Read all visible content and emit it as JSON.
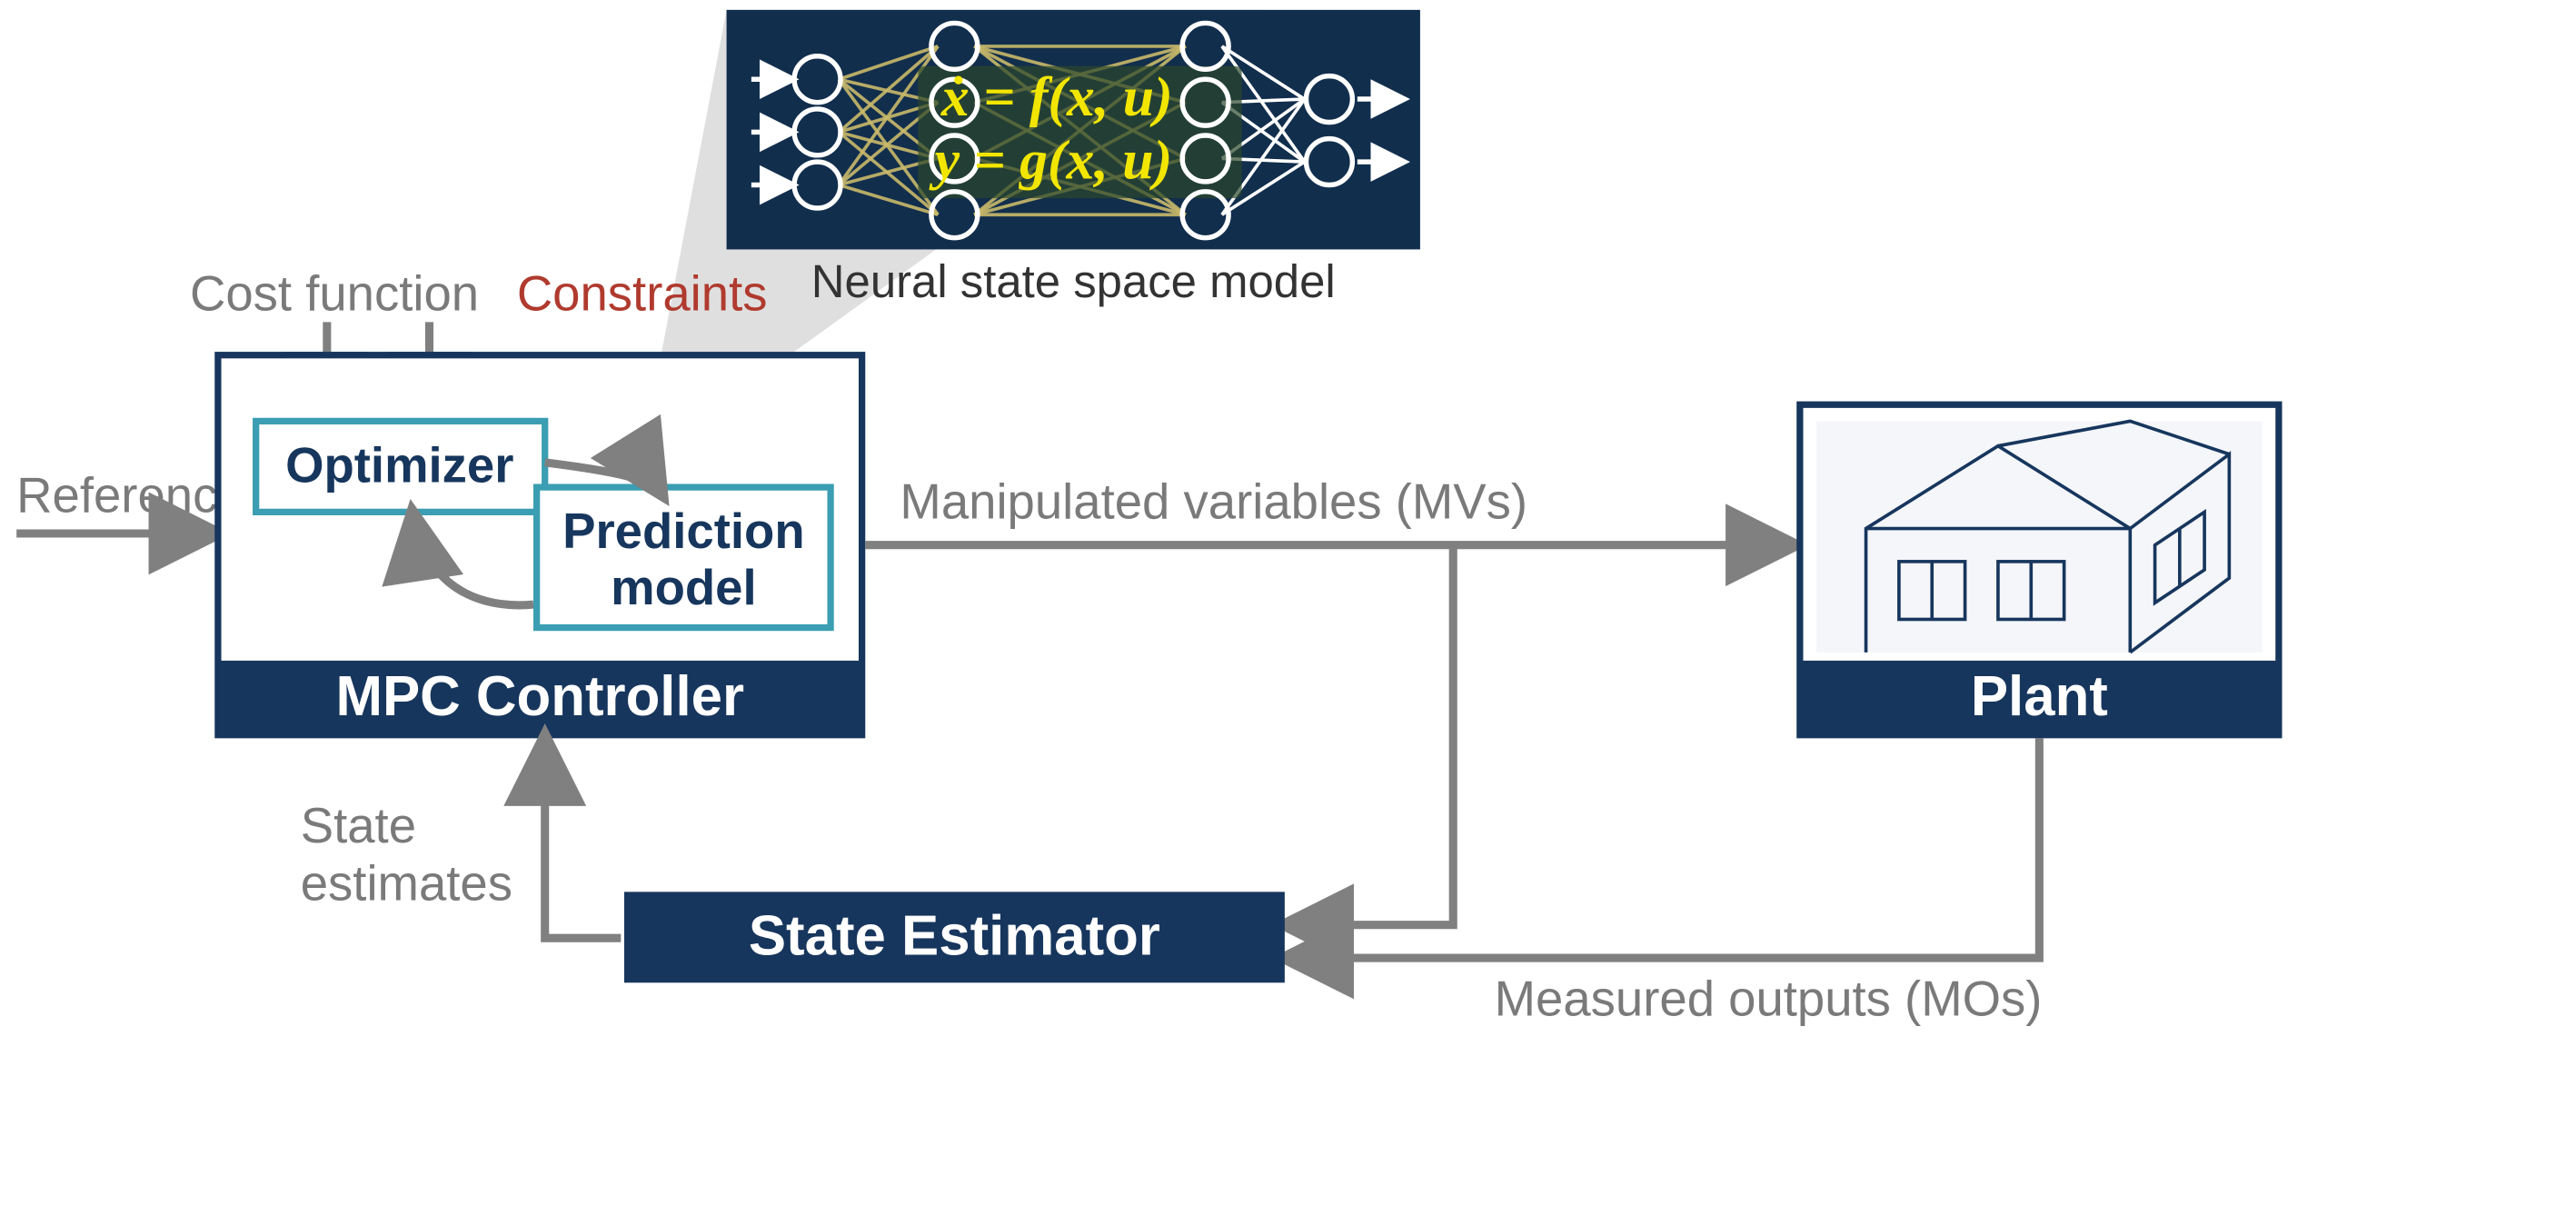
{
  "labels": {
    "reference": "Reference",
    "cost_function": "Cost function",
    "constraints": "Constraints",
    "mvs": "Manipulated variables (MVs)",
    "mos": "Measured outputs (MOs)",
    "state_est_line1": "State",
    "state_est_line2": "estimates",
    "nn_caption": "Neural state space model"
  },
  "blocks": {
    "mpc_footer": "MPC Controller",
    "plant_footer": "Plant",
    "state_estimator": "State Estimator",
    "optimizer": "Optimizer",
    "pred_line1": "Prediction",
    "pred_line2": "model"
  },
  "nn": {
    "eq1": "ẋ = f(x, u)",
    "eq2": "y = g(x, u)"
  }
}
